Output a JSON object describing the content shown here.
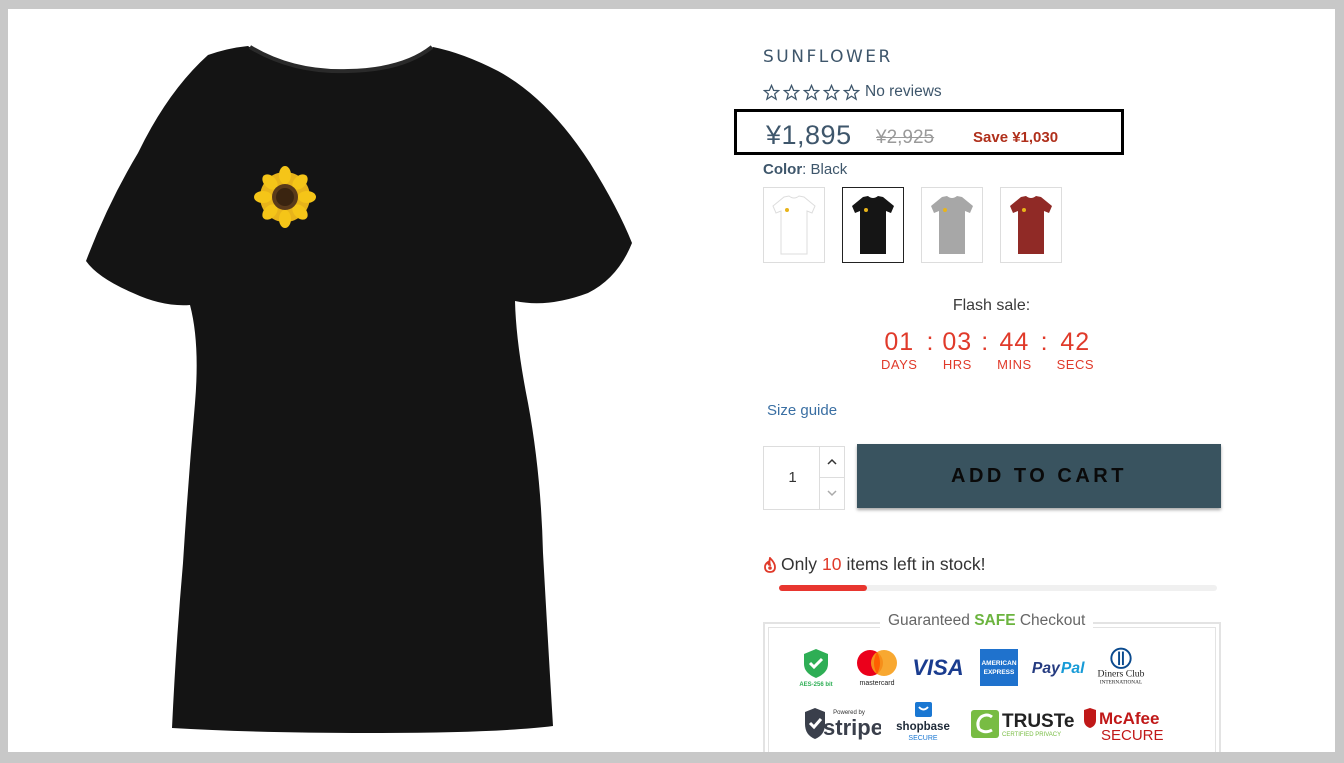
{
  "product": {
    "title": "SUNFLOWER",
    "rating": {
      "stars": 0,
      "max": 5,
      "reviews_text": "No reviews"
    },
    "price": "¥1,895",
    "compare_price": "¥2,925",
    "save_text": "Save ¥1,030",
    "color_label": "Color",
    "color_value": "Black",
    "swatches": [
      {
        "name": "White",
        "color": "#ffffff",
        "selected": false
      },
      {
        "name": "Black",
        "color": "#151515",
        "selected": true
      },
      {
        "name": "Grey",
        "color": "#a7a7a7",
        "selected": false
      },
      {
        "name": "Red",
        "color": "#902a26",
        "selected": false
      }
    ]
  },
  "flash_sale": {
    "label": "Flash sale:",
    "days": "01",
    "hours": "03",
    "mins": "44",
    "secs": "42",
    "days_label": "DAYS",
    "hours_label": "HRS",
    "mins_label": "MINS",
    "secs_label": "SECS",
    "separator": ":"
  },
  "size_guide": "Size guide",
  "quantity": "1",
  "add_to_cart": "ADD TO CART",
  "stock": {
    "prefix": "Only",
    "count": "10",
    "suffix": "items left in stock!",
    "level": 0.2
  },
  "checkout": {
    "title_pre": "Guaranteed",
    "title_safe": "SAFE",
    "title_post": "Checkout",
    "badges": [
      "aes-256-bit",
      "mastercard",
      "visa",
      "american-express",
      "paypal",
      "diners-club",
      "stripe",
      "shopbase-secure",
      "truste",
      "mcafee-secure"
    ],
    "texts": {
      "aes": "AES-256 bit",
      "mastercard": "mastercard",
      "visa": "VISA",
      "amex_1": "AMERICAN",
      "amex_2": "EXPRESS",
      "paypal_1": "Pay",
      "paypal_2": "Pal",
      "diners_1": "Diners Club",
      "diners_2": "INTERNATIONAL",
      "stripe_small": "Powered by",
      "stripe": "stripe",
      "shopbase_1": "shopbase",
      "shopbase_2": "SECURE",
      "truste_1": "TRUSTe",
      "truste_2": "CERTIFIED PRIVACY",
      "mcafee_1": "McAfee",
      "mcafee_2": "SECURE"
    }
  },
  "colors": {
    "accent": "#39535f",
    "text": "#3e566b",
    "sale": "#e03a2a",
    "save": "#b0301c",
    "safe": "#6cb43f"
  }
}
